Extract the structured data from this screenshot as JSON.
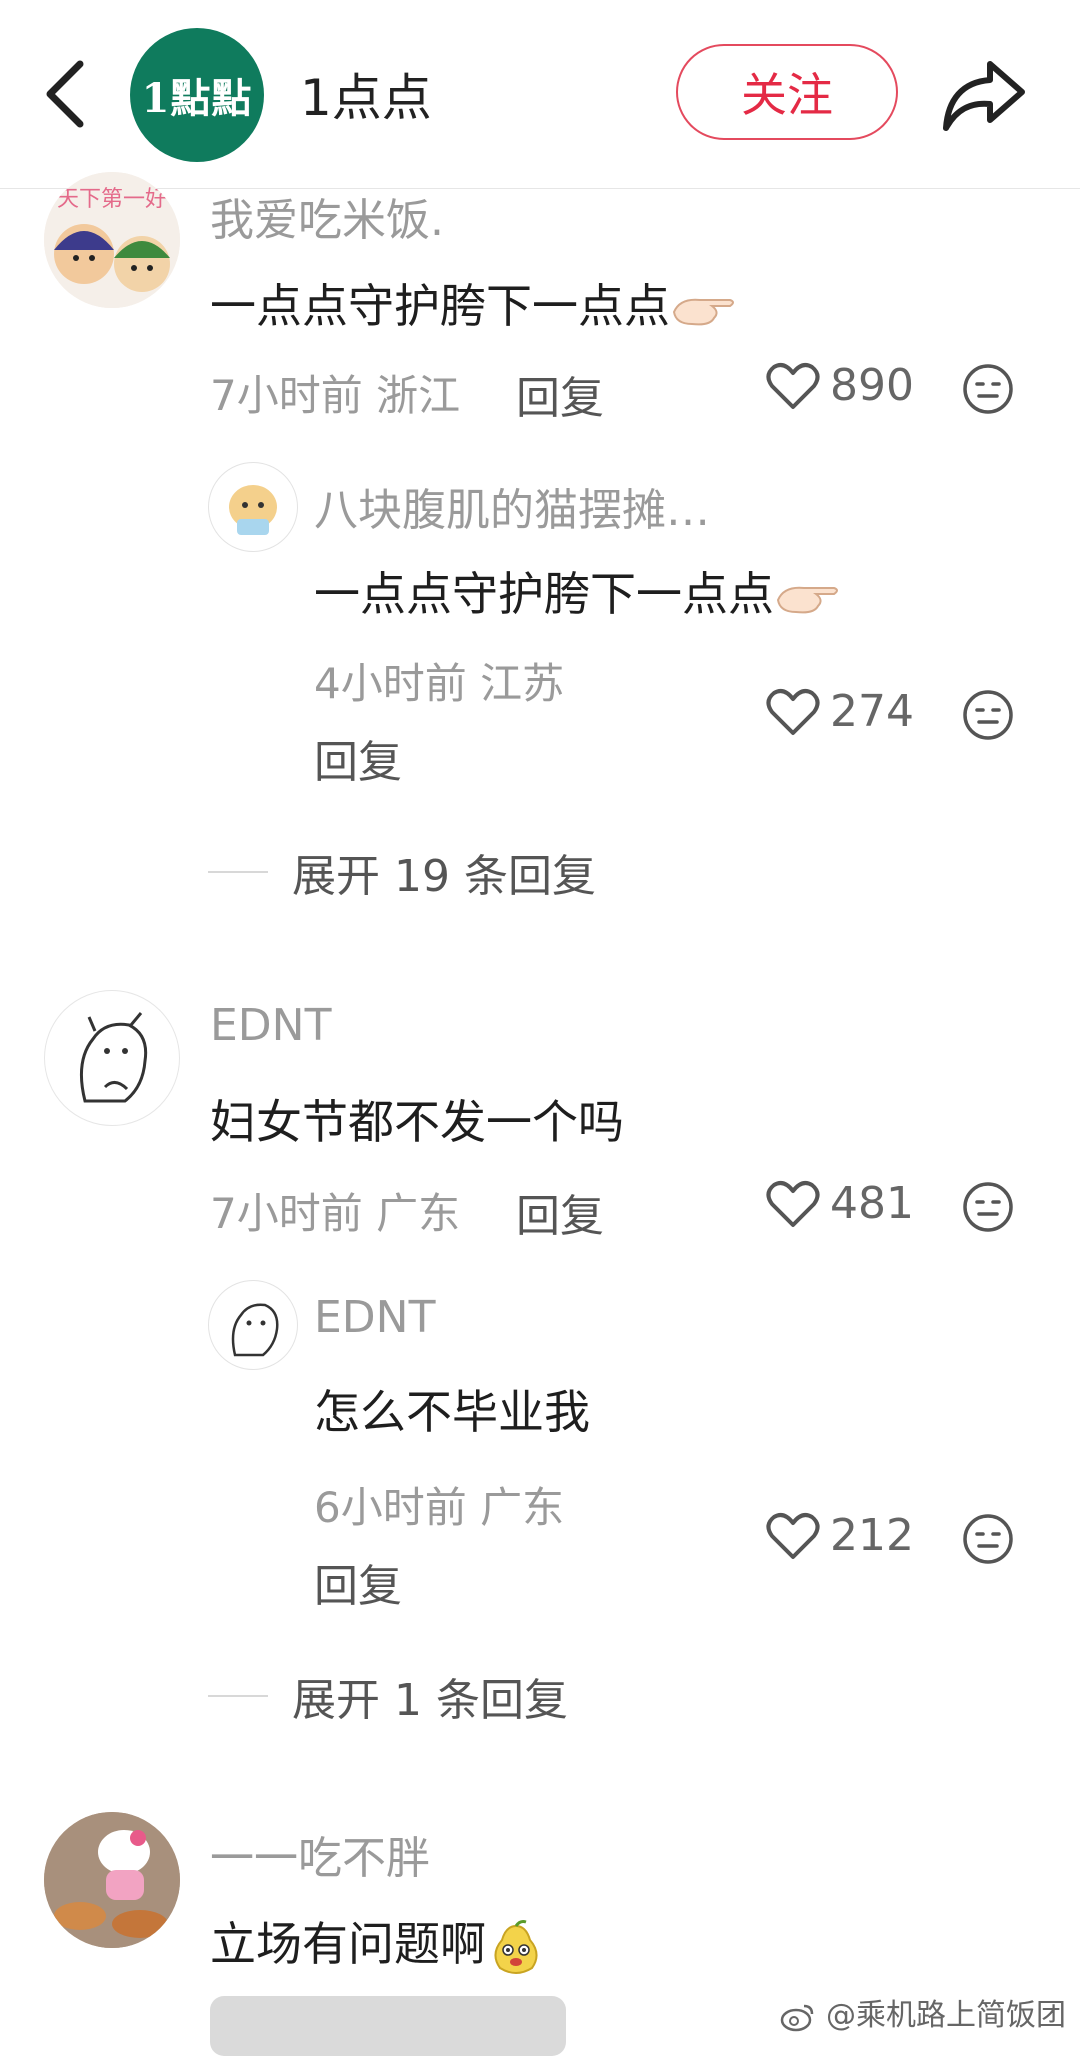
{
  "header": {
    "logo_text": "1點點",
    "title": "1点点",
    "follow_label": "关注"
  },
  "colors": {
    "accent": "#e42a45",
    "brand_green": "#0f7b5d"
  },
  "comments": [
    {
      "name": "我爱吃米饭.",
      "text": "一点点守护胯下一点点",
      "time": "7小时前",
      "region": "浙江",
      "reply_label": "回复",
      "likes": "890",
      "sub_reply": {
        "name": "八块腹肌的猫摆摊…",
        "text": "一点点守护胯下一点点",
        "time": "4小时前",
        "region": "江苏",
        "reply_label": "回复",
        "likes": "274"
      },
      "expand_label": "展开 19 条回复"
    },
    {
      "name": "EDNT",
      "text": "妇女节都不发一个吗",
      "time": "7小时前",
      "region": "广东",
      "reply_label": "回复",
      "likes": "481",
      "sub_reply": {
        "name": "EDNT",
        "text": "怎么不毕业我",
        "time": "6小时前",
        "region": "广东",
        "reply_label": "回复",
        "likes": "212"
      },
      "expand_label": "展开 1 条回复"
    },
    {
      "name": "一一吃不胖",
      "text": "立场有问题啊"
    }
  ],
  "watermark": "@乘机路上简饭团"
}
